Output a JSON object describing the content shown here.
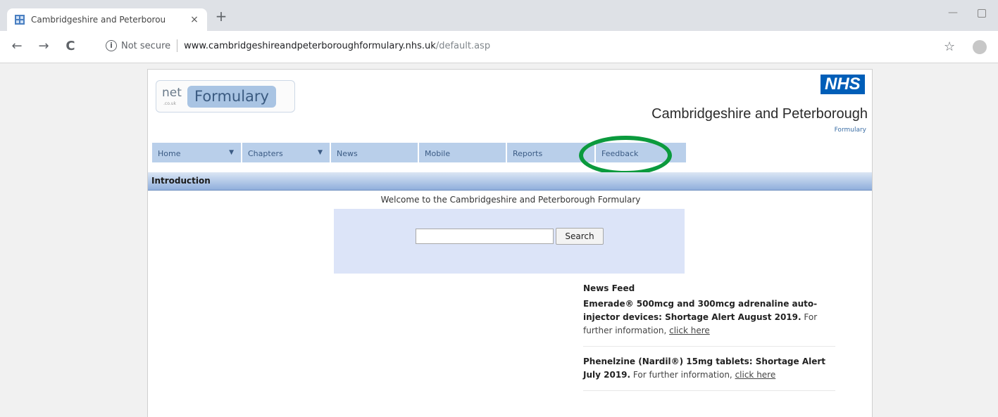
{
  "browser": {
    "tab_title": "Cambridgeshire and Peterborou",
    "tab_close": "×",
    "new_tab": "+",
    "back": "←",
    "forward": "→",
    "reload": "C",
    "security_label": "Not secure",
    "url_host": "www.cambridgeshireandpeterboroughformulary.nhs.uk",
    "url_path": "/default.asp",
    "bookmark_star": "☆"
  },
  "header": {
    "logo_net": "net",
    "logo_sub": ".co.uk",
    "logo_formulary": "Formulary",
    "nhs": "NHS",
    "org_name": "Cambridgeshire and Peterborough",
    "org_sub": "Formulary"
  },
  "menu": [
    {
      "label": "Home",
      "dropdown": true
    },
    {
      "label": "Chapters",
      "dropdown": true
    },
    {
      "label": "News",
      "dropdown": false
    },
    {
      "label": "Mobile",
      "dropdown": false
    },
    {
      "label": "Reports",
      "dropdown": false
    },
    {
      "label": "Feedback",
      "dropdown": false
    }
  ],
  "menu_arrow": "▼",
  "highlight_color": "#0b9a3d",
  "intro": {
    "title": "Introduction",
    "welcome": "Welcome to the Cambridgeshire and Peterborough Formulary"
  },
  "search": {
    "value": "",
    "button": "Search"
  },
  "news": {
    "heading": "News Feed",
    "items": [
      {
        "bold": "Emerade® 500mcg and 300mcg adrenaline auto-injector devices: Shortage Alert August 2019.",
        "text": " For further information, ",
        "link": "click here"
      },
      {
        "bold": "Phenelzine (Nardil®) 15mg tablets: Shortage Alert July 2019.",
        "text": " For further information, ",
        "link": "click here"
      }
    ]
  }
}
